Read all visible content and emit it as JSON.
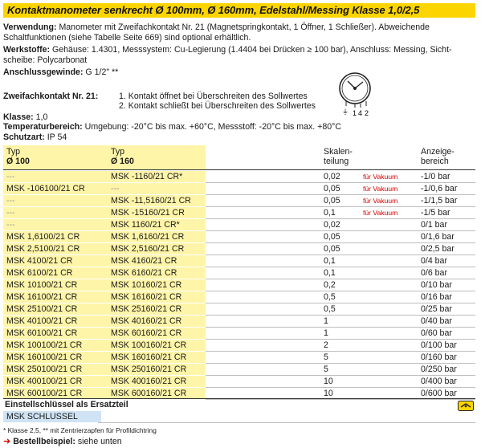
{
  "title": "Kontaktmanometer senkrecht Ø 100mm, Ø 160mm, Edelstahl/Messing   Klasse 1,0/2,5",
  "verwendung": {
    "label": "Verwendung:",
    "text1": " Manometer mit Zweifachkontakt Nr. 21 (Magnetspringkontakt, 1 Öffner, 1 Schließer). Abweichende",
    "text2": "Schaltfunktionen (siehe Tabelle Seite 669) sind optional erhältlich."
  },
  "werkstoffe": {
    "label": "Werkstoffe:",
    "text1": " Gehäuse: 1.4301, Messsystem: Cu-Legierung (1.4404 bei Drücken ≥ 100 bar), Anschluss: Messing, Sicht-",
    "text2": "scheibe: Polycarbonat"
  },
  "anschluss": {
    "label": "Anschlussgewinde:",
    "value": " G 1/2\" **"
  },
  "zweifach": {
    "label": "Zweifachkontakt Nr. 21:",
    "items": [
      "1. Kontakt öffnet bei Überschreiten des Sollwertes",
      "2. Kontakt schließt bei Überschreiten des Sollwertes"
    ],
    "diagram_labels": [
      "⏚",
      "1",
      "4",
      "2"
    ]
  },
  "klasse": {
    "label": "Klasse:",
    "value": " 1,0"
  },
  "temperatur": {
    "label": "Temperaturbereich:",
    "value": " Umgebung: -20°C bis max. +60°C, Messstoff: -20°C bis max. +80°C"
  },
  "schutzart": {
    "label": "Schutzart:",
    "value": " IP 54"
  },
  "table": {
    "headers": {
      "typ100_a": "Typ",
      "typ100_b": "Ø 100",
      "typ160_a": "Typ",
      "typ160_b": "Ø 160",
      "scale_a": "Skalen-",
      "scale_b": "teilung",
      "range_a": "Anzeige-",
      "range_b": "bereich"
    },
    "rows": [
      {
        "t100": "---",
        "t160": "MSK -1160/21 CR*",
        "scale": "0,02",
        "vak": "für Vakuum",
        "range": "-1/0 bar"
      },
      {
        "t100": "MSK -106100/21 CR",
        "t160": "---",
        "scale": "0,05",
        "vak": "für Vakuum",
        "range": "-1/0,6 bar"
      },
      {
        "t100": "---",
        "t160": "MSK -11,5160/21 CR",
        "scale": "0,05",
        "vak": "für Vakuum",
        "range": "-1/1,5 bar"
      },
      {
        "t100": "---",
        "t160": "MSK -15160/21 CR",
        "scale": "0,1",
        "vak": "für Vakuum",
        "range": "-1/5 bar"
      },
      {
        "t100": "---",
        "t160": "MSK 1160/21 CR*",
        "scale": "0,02",
        "vak": "",
        "range": "0/1 bar"
      },
      {
        "t100": "MSK 1,6100/21 CR",
        "t160": "MSK 1,6160/21 CR",
        "scale": "0,05",
        "vak": "",
        "range": "0/1,6 bar"
      },
      {
        "t100": "MSK 2,5100/21 CR",
        "t160": "MSK 2,5160/21 CR",
        "scale": "0,05",
        "vak": "",
        "range": "0/2,5 bar"
      },
      {
        "t100": "MSK 4100/21 CR",
        "t160": "MSK 4160/21 CR",
        "scale": "0,1",
        "vak": "",
        "range": "0/4 bar"
      },
      {
        "t100": "MSK 6100/21 CR",
        "t160": "MSK 6160/21 CR",
        "scale": "0,1",
        "vak": "",
        "range": "0/6 bar"
      },
      {
        "t100": "MSK 10100/21 CR",
        "t160": "MSK 10160/21 CR",
        "scale": "0,2",
        "vak": "",
        "range": "0/10 bar"
      },
      {
        "t100": "MSK 16100/21 CR",
        "t160": "MSK 16160/21 CR",
        "scale": "0,5",
        "vak": "",
        "range": "0/16 bar"
      },
      {
        "t100": "MSK 25100/21 CR",
        "t160": "MSK 25160/21 CR",
        "scale": "0,5",
        "vak": "",
        "range": "0/25 bar"
      },
      {
        "t100": "MSK 40100/21 CR",
        "t160": "MSK 40160/21 CR",
        "scale": "1",
        "vak": "",
        "range": "0/40 bar"
      },
      {
        "t100": "MSK 60100/21 CR",
        "t160": "MSK 60160/21 CR",
        "scale": "1",
        "vak": "",
        "range": "0/60 bar"
      },
      {
        "t100": "MSK 100100/21 CR",
        "t160": "MSK 100160/21 CR",
        "scale": "2",
        "vak": "",
        "range": "0/100 bar"
      },
      {
        "t100": "MSK 160100/21 CR",
        "t160": "MSK 160160/21 CR",
        "scale": "5",
        "vak": "",
        "range": "0/160 bar"
      },
      {
        "t100": "MSK 250100/21 CR",
        "t160": "MSK 250160/21 CR",
        "scale": "5",
        "vak": "",
        "range": "0/250 bar"
      },
      {
        "t100": "MSK 400100/21 CR",
        "t160": "MSK 400160/21 CR",
        "scale": "10",
        "vak": "",
        "range": "0/400 bar"
      },
      {
        "t100": "MSK 600100/21 CR",
        "t160": "MSK 600160/21 CR",
        "scale": "10",
        "vak": "",
        "range": "0/600 bar"
      }
    ]
  },
  "ersatz": {
    "title": "Einstellschlüssel als Ersatzteil",
    "item": "MSK SCHLUSSEL",
    "icon": "key-tool-icon"
  },
  "footnote": "* Klasse 2,5, ** mit Zentrierzapfen für Profildichtring",
  "bestell": {
    "label": "Bestellbeispiel:",
    "text": " siehe unten"
  },
  "colors": {
    "yellow": "#fcd500",
    "light_yellow": "#fff5a8",
    "red": "#d40000",
    "blue": "#cfe3f4"
  }
}
